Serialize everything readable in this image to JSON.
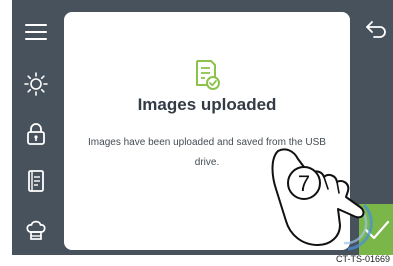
{
  "dialog": {
    "title": "Images uploaded",
    "message": "Images have been uploaded and saved from the USB drive.",
    "icon": "document-check-icon"
  },
  "left_rail": {
    "items": [
      {
        "icon": "menu-icon"
      },
      {
        "icon": "brightness-icon"
      },
      {
        "icon": "lock-icon"
      },
      {
        "icon": "recipe-book-icon"
      },
      {
        "icon": "chef-hat-icon"
      }
    ]
  },
  "right_rail": {
    "back_icon": "back-arrow-icon",
    "confirm_icon": "checkmark-icon"
  },
  "overlay": {
    "step_number": "7"
  },
  "caption": "CT-TS-01669",
  "colors": {
    "panel": "#48525c",
    "accent_green": "#7ab648",
    "icon_green": "#8bc34a",
    "dialog_bg": "#ffffff"
  }
}
